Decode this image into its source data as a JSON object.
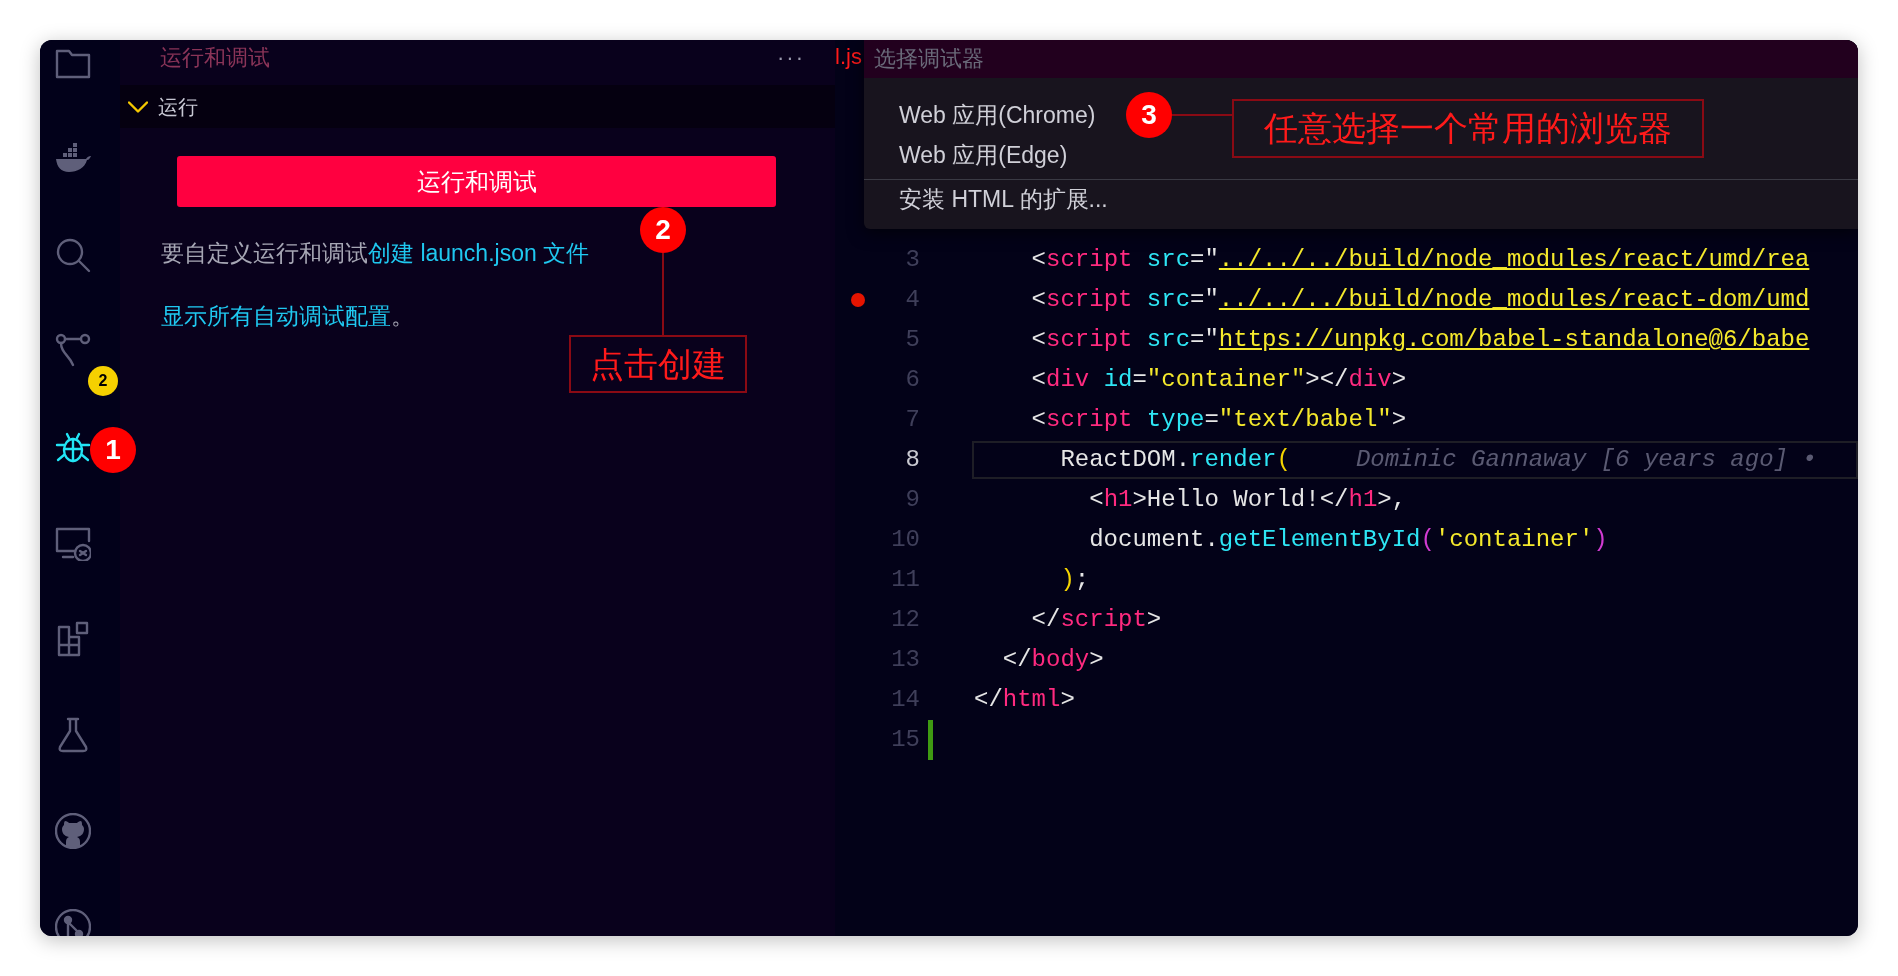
{
  "activity_bar": {
    "items": [
      {
        "kind": "files",
        "selected": false
      },
      {
        "kind": "docker",
        "selected": false
      },
      {
        "kind": "search",
        "selected": false
      },
      {
        "kind": "source_control",
        "selected": false,
        "badge": "2"
      },
      {
        "kind": "debug",
        "selected": true,
        "callout": "1"
      },
      {
        "kind": "remote",
        "selected": false
      },
      {
        "kind": "extensions",
        "selected": false
      },
      {
        "kind": "testing",
        "selected": false
      },
      {
        "kind": "github",
        "selected": false
      },
      {
        "kind": "pull_requests",
        "selected": false
      }
    ]
  },
  "sidebar": {
    "title": "运行和调试",
    "more": "···",
    "section": {
      "label": "运行",
      "expanded": true
    },
    "run_button": "运行和调试",
    "paragraphs": [
      [
        {
          "text": "要自定义运行和调试",
          "link": false
        },
        {
          "text": "创建 launch.json 文件",
          "link": true
        }
      ],
      [
        {
          "text": "显示所有自动调试配置",
          "link": true
        },
        {
          "text": "。",
          "link": false
        }
      ]
    ],
    "callout": {
      "number": "2",
      "label": "点击创建"
    }
  },
  "editor": {
    "tab_fragment": "l.js",
    "quick_pick": {
      "placeholder": "选择调试器",
      "items": [
        {
          "label": "Web 应用(Chrome)",
          "separator": false,
          "callout": {
            "number": "3",
            "label": "任意选择一个常用的浏览器"
          }
        },
        {
          "label": "Web 应用(Edge)",
          "separator": false
        },
        {
          "label": "安装 HTML 的扩展...",
          "separator": true
        }
      ]
    },
    "lines": [
      {
        "number": "3",
        "breakpoint": false,
        "current": false,
        "tokens": [
          {
            "kind": "punct",
            "text": "    <"
          },
          {
            "kind": "tag",
            "text": "script"
          },
          {
            "kind": "attr",
            "text": " src"
          },
          {
            "kind": "punct",
            "text": "=\""
          },
          {
            "kind": "link",
            "text": "../../../build/node_modules/react/umd/rea"
          }
        ]
      },
      {
        "number": "4",
        "breakpoint": true,
        "current": false,
        "tokens": [
          {
            "kind": "punct",
            "text": "    <"
          },
          {
            "kind": "tag",
            "text": "script"
          },
          {
            "kind": "attr",
            "text": " src"
          },
          {
            "kind": "punct",
            "text": "=\""
          },
          {
            "kind": "link",
            "text": "../../../build/node_modules/react-dom/umd"
          }
        ]
      },
      {
        "number": "5",
        "breakpoint": false,
        "current": false,
        "tokens": [
          {
            "kind": "punct",
            "text": "    <"
          },
          {
            "kind": "tag",
            "text": "script"
          },
          {
            "kind": "attr",
            "text": " src"
          },
          {
            "kind": "punct",
            "text": "=\""
          },
          {
            "kind": "link",
            "text": "https://unpkg.com/babel-standalone@6/babe"
          }
        ]
      },
      {
        "number": "6",
        "breakpoint": false,
        "current": false,
        "tokens": [
          {
            "kind": "punct",
            "text": "    <"
          },
          {
            "kind": "tag",
            "text": "div"
          },
          {
            "kind": "attr",
            "text": " id"
          },
          {
            "kind": "punct",
            "text": "="
          },
          {
            "kind": "str",
            "text": "\"container\""
          },
          {
            "kind": "punct",
            "text": "></"
          },
          {
            "kind": "tag",
            "text": "div"
          },
          {
            "kind": "punct",
            "text": ">"
          }
        ]
      },
      {
        "number": "7",
        "breakpoint": false,
        "current": false,
        "tokens": [
          {
            "kind": "punct",
            "text": "    <"
          },
          {
            "kind": "tag",
            "text": "script"
          },
          {
            "kind": "attr",
            "text": " type"
          },
          {
            "kind": "punct",
            "text": "="
          },
          {
            "kind": "str",
            "text": "\"text/babel\""
          },
          {
            "kind": "punct",
            "text": ">"
          }
        ]
      },
      {
        "number": "8",
        "breakpoint": false,
        "current": true,
        "tokens": [
          {
            "kind": "text",
            "text": "      ReactDOM."
          },
          {
            "kind": "func",
            "text": "render"
          },
          {
            "kind": "bracket1",
            "text": "("
          }
        ],
        "blame": "Dominic Gannaway [6 years ago] •"
      },
      {
        "number": "9",
        "breakpoint": false,
        "current": false,
        "tokens": [
          {
            "kind": "punct",
            "text": "        <"
          },
          {
            "kind": "tag",
            "text": "h1"
          },
          {
            "kind": "text",
            "text": ">Hello World!</"
          },
          {
            "kind": "tag",
            "text": "h1"
          },
          {
            "kind": "punct",
            "text": ">,"
          }
        ]
      },
      {
        "number": "10",
        "breakpoint": false,
        "current": false,
        "tokens": [
          {
            "kind": "text",
            "text": "        document."
          },
          {
            "kind": "func",
            "text": "getElementById"
          },
          {
            "kind": "bracket2",
            "text": "("
          },
          {
            "kind": "str",
            "text": "'container'"
          },
          {
            "kind": "bracket2",
            "text": ")"
          }
        ]
      },
      {
        "number": "11",
        "breakpoint": false,
        "current": false,
        "tokens": [
          {
            "kind": "bracket1",
            "text": "      )"
          },
          {
            "kind": "punct",
            "text": ";"
          }
        ]
      },
      {
        "number": "12",
        "breakpoint": false,
        "current": false,
        "tokens": [
          {
            "kind": "punct",
            "text": "    </"
          },
          {
            "kind": "tag",
            "text": "script"
          },
          {
            "kind": "punct",
            "text": ">"
          }
        ]
      },
      {
        "number": "13",
        "breakpoint": false,
        "current": false,
        "tokens": [
          {
            "kind": "punct",
            "text": "  </"
          },
          {
            "kind": "tag",
            "text": "body"
          },
          {
            "kind": "punct",
            "text": ">"
          }
        ]
      },
      {
        "number": "14",
        "breakpoint": false,
        "current": false,
        "tokens": [
          {
            "kind": "punct",
            "text": "</"
          },
          {
            "kind": "tag",
            "text": "html"
          },
          {
            "kind": "punct",
            "text": ">"
          }
        ]
      },
      {
        "number": "15",
        "breakpoint": false,
        "current": false,
        "added": true
      }
    ]
  }
}
